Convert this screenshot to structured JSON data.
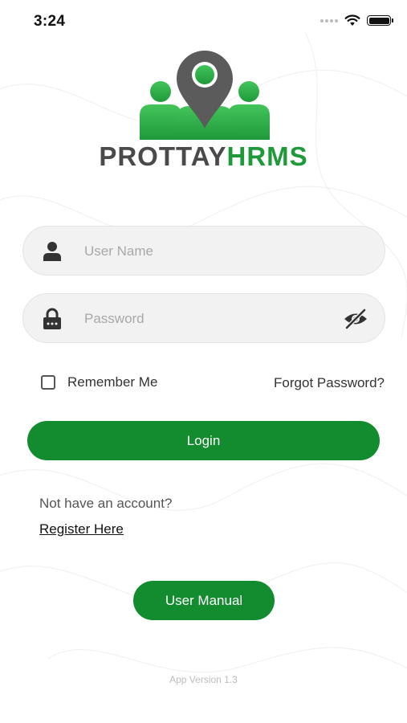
{
  "status_bar": {
    "time": "3:24"
  },
  "brand": {
    "part1": "PROTTAY",
    "part2": "HRMS"
  },
  "login_form": {
    "username_placeholder": "User Name",
    "password_placeholder": "Password",
    "remember_label": "Remember Me",
    "remember_checked": false,
    "forgot_label": "Forgot Password?",
    "login_label": "Login"
  },
  "register": {
    "prompt": "Not have an account?",
    "link_label": "Register Here"
  },
  "user_manual_label": "User Manual",
  "version": "App Version 1.3",
  "colors": {
    "primary": "#128c2e",
    "logo_green": "#2fb34a",
    "pin_gray": "#5b5b5b"
  },
  "icons": {
    "username": "person-icon",
    "password": "lock-icon",
    "visibility": "eye-off-icon",
    "logo": "location-pin-team-icon"
  }
}
